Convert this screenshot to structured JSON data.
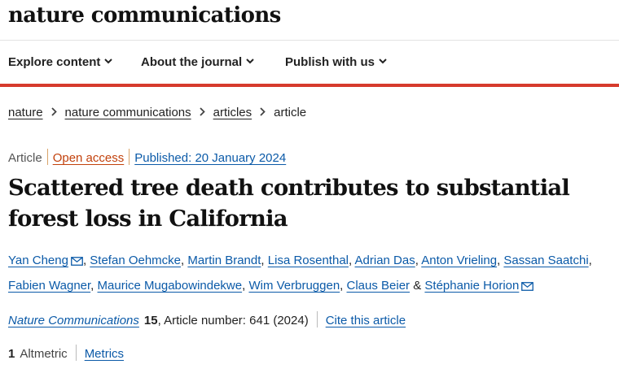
{
  "site": {
    "brand": "nature communications"
  },
  "nav": {
    "items": [
      {
        "label": "Explore content"
      },
      {
        "label": "About the journal"
      },
      {
        "label": "Publish with us"
      }
    ]
  },
  "breadcrumb": [
    "nature",
    "nature communications",
    "articles",
    "article"
  ],
  "article": {
    "type": "Article",
    "access": "Open access",
    "published": "Published: 20 January 2024",
    "title": "Scattered tree death contributes to substantial forest loss in California",
    "authors": [
      "Yan Cheng",
      "Stefan Oehmcke",
      "Martin Brandt",
      "Lisa Rosenthal",
      "Adrian Das",
      "Anton Vrieling",
      "Sassan Saatchi",
      "Fabien Wagner",
      "Maurice Mugabowindekwe",
      "Wim Verbruggen",
      "Claus Beier",
      "Stéphanie Horion"
    ],
    "author_separator": ", ",
    "author_final_separator": "&",
    "journal": "Nature Communications",
    "volume": "15",
    "article_number": ", Article number: 641 (2024)",
    "cite_label": "Cite this article"
  },
  "metrics": {
    "altmetric_count": "1",
    "altmetric_label": "Altmetric",
    "metrics_link": "Metrics"
  },
  "colors": {
    "link": "#0b5aa8",
    "accent_rule": "#d63a2c",
    "open_access": "#c2410c"
  },
  "icons": [
    "chevron-down-icon",
    "chevron-right-icon",
    "mail-icon"
  ]
}
